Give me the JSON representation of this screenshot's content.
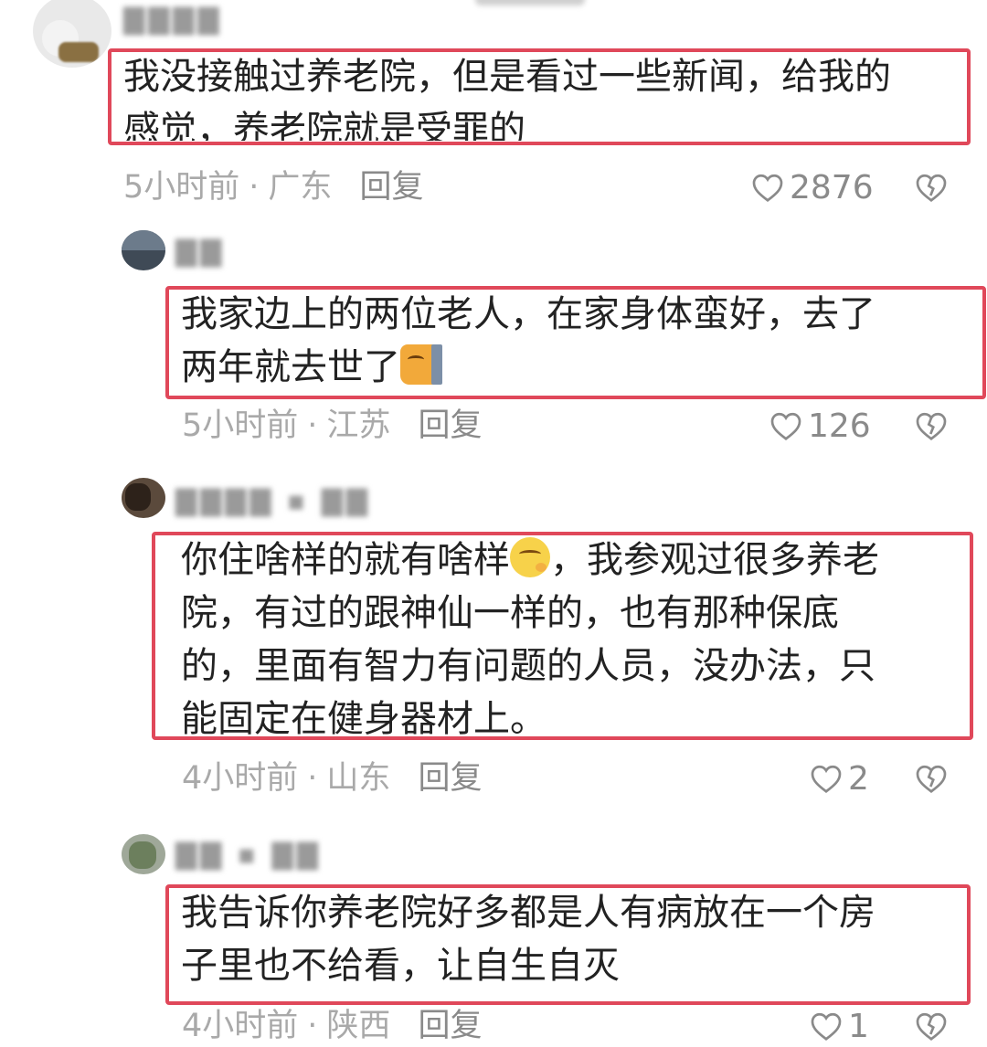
{
  "comments": [
    {
      "text": "我没接触过养老院，但是看过一些新闻，给我的",
      "text_line2": "感觉，养老院就是受罪的",
      "time": "5小时前",
      "location": "广东",
      "reply_label": "回复",
      "likes": "2876"
    },
    {
      "text_line1": "我家边上的两位老人，在家身体蛮好，去了",
      "text_line2": "两年就去世了",
      "emoji": "cat-wall-emoji",
      "time": "5小时前",
      "location": "江苏",
      "reply_label": "回复",
      "likes": "126"
    },
    {
      "text_line1_a": "你住啥样的就有啥样",
      "text_line1_b": "，我参观过很多养老",
      "text_line2": "院，有过的跟神仙一样的，也有那种保底",
      "text_line3": "的，里面有智力有问题的人员，没办法，只",
      "text_line4": "能固定在健身器材上。",
      "emoji": "thinking-face-emoji",
      "time": "4小时前",
      "location": "山东",
      "reply_label": "回复",
      "likes": "2"
    },
    {
      "text_line1": "我告诉你养老院好多都是人有病放在一个房",
      "text_line2": "子里也不给看，让自生自灭",
      "time": "4小时前",
      "location": "陕西",
      "reply_label": "回复",
      "likes": "1"
    }
  ],
  "separator": "·",
  "colors": {
    "highlight_border": "#e0485a",
    "meta_text": "#a9a9a9"
  }
}
